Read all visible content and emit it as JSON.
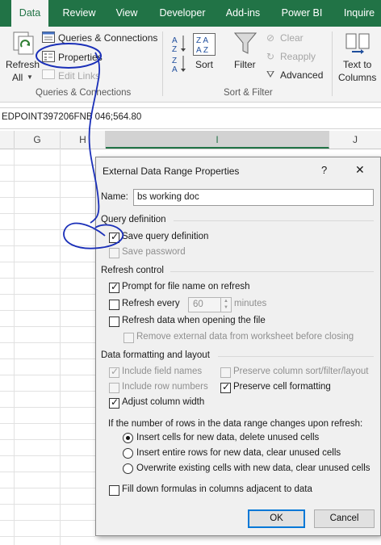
{
  "ribbon": {
    "tabs": [
      "Data",
      "Review",
      "View",
      "Developer",
      "Add-ins",
      "Power BI",
      "Inquire"
    ],
    "active_tab": "Data",
    "refresh_all": "Refresh",
    "refresh_all_2": "All",
    "queries_connections": "Queries & Connections",
    "properties": "Properties",
    "edit_links": "Edit Links",
    "group_queries": "Queries & Connections",
    "sort": "Sort",
    "filter": "Filter",
    "clear": "Clear",
    "reapply": "Reapply",
    "advanced": "Advanced",
    "group_sort_filter": "Sort & Filter",
    "text_to": "Text to",
    "columns": "Columns"
  },
  "formula_bar": {
    "content": "EDPOINT397206FNB 046;564.80"
  },
  "columns": [
    "G",
    "H",
    "I",
    "J"
  ],
  "dialog": {
    "title": "External Data Range Properties",
    "help": "?",
    "close": "✕",
    "name_label": "Name:",
    "name_value": "bs working doc",
    "query_definition": "Query definition",
    "save_query_definition": "Save query definition",
    "save_password": "Save password",
    "refresh_control": "Refresh control",
    "prompt_file_name": "Prompt for file name on refresh",
    "refresh_every": "Refresh every",
    "refresh_minutes_value": "60",
    "minutes": "minutes",
    "refresh_on_open": "Refresh data when opening the file",
    "remove_external": "Remove external data from worksheet before closing",
    "data_formatting": "Data formatting and layout",
    "include_field_names": "Include field names",
    "preserve_sort": "Preserve column sort/filter/layout",
    "include_row_numbers": "Include row numbers",
    "preserve_cell_formatting": "Preserve cell formatting",
    "adjust_column_width": "Adjust column width",
    "rows_change_prompt": "If the number of rows in the data range changes upon refresh:",
    "option_insert_cells": "Insert cells for new data, delete unused cells",
    "option_insert_rows": "Insert entire rows for new data, clear unused cells",
    "option_overwrite": "Overwrite existing cells with new data, clear unused cells",
    "fill_down": "Fill down formulas in columns adjacent to data",
    "ok": "OK",
    "cancel": "Cancel"
  },
  "colors": {
    "ribbon_green": "#217346",
    "annotation": "#1a2fb8"
  }
}
